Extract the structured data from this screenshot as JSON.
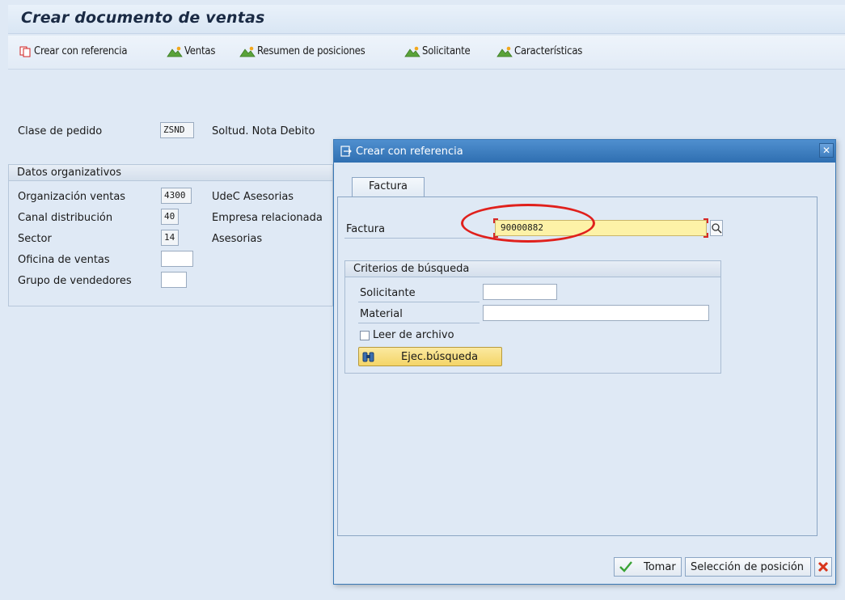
{
  "header": {
    "title": "Crear documento de ventas"
  },
  "toolbar": {
    "items": [
      {
        "label": "Crear con referencia",
        "icon": "copy-doc-icon"
      },
      {
        "label": "Ventas",
        "icon": "mountain-icon"
      },
      {
        "label": "Resumen de posiciones",
        "icon": "mountain-icon"
      },
      {
        "label": "Solicitante",
        "icon": "mountain-icon"
      },
      {
        "label": "Características",
        "icon": "mountain-icon"
      }
    ]
  },
  "order": {
    "label": "Clase de pedido",
    "value": "ZSND",
    "description": "Soltud. Nota Debito"
  },
  "org": {
    "title": "Datos organizativos",
    "rows": [
      {
        "label": "Organización ventas",
        "value": "4300",
        "description": "UdeC Asesorias"
      },
      {
        "label": "Canal distribución",
        "value": "40",
        "description": "Empresa relacionada"
      },
      {
        "label": "Sector",
        "value": "14",
        "description": "Asesorias"
      },
      {
        "label": "Oficina de ventas",
        "value": "",
        "description": ""
      },
      {
        "label": "Grupo de vendedores",
        "value": "",
        "description": ""
      }
    ]
  },
  "dialog": {
    "title": "Crear con referencia",
    "close_icon": "close-icon",
    "tab_label": "Factura",
    "factura_label": "Factura",
    "factura_value": "90000882",
    "criteria": {
      "title": "Criterios de búsqueda",
      "solicitante_label": "Solicitante",
      "solicitante_value": "",
      "material_label": "Material",
      "material_value": "",
      "archivo_label": "Leer de archivo",
      "search_button": "Ejec.búsqueda"
    },
    "buttons": {
      "tomar": "Tomar",
      "seleccion": "Selección de posición"
    }
  },
  "colors": {
    "accent": "#2f6fb1",
    "required_field": "#fdf2a7",
    "annotation": "#e0201c"
  }
}
